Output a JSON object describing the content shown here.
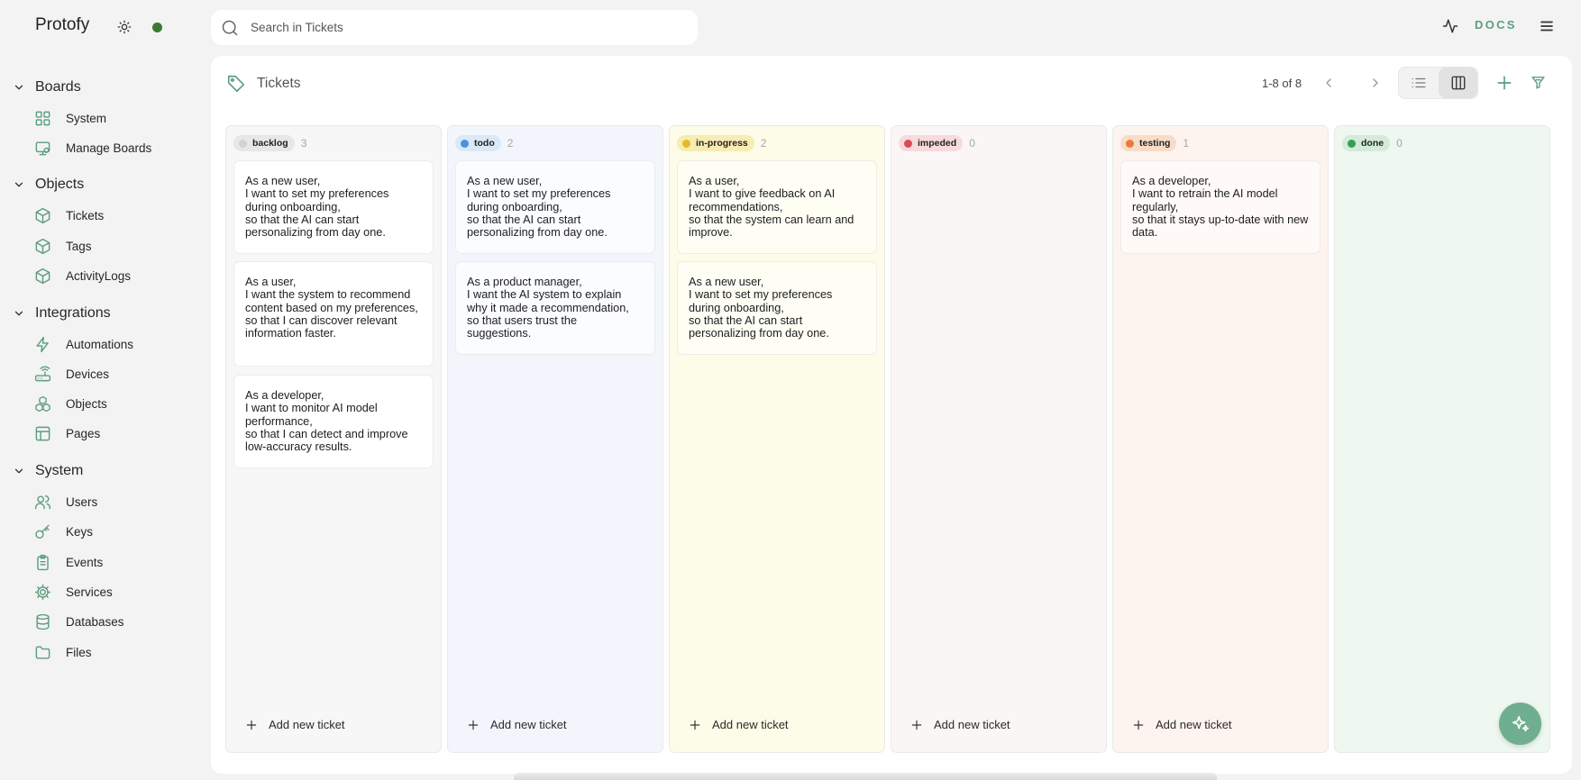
{
  "app": {
    "name": "Protofy",
    "status_color": "#3b7a35",
    "accent": "#5d9e7e"
  },
  "topbar": {
    "search_placeholder": "Search in Tickets",
    "docs_label": "DOCS"
  },
  "sidebar": {
    "sections": [
      {
        "title": "Boards",
        "items": [
          {
            "label": "System",
            "icon": "grid-icon"
          },
          {
            "label": "Manage Boards",
            "icon": "monitor-icon"
          }
        ]
      },
      {
        "title": "Objects",
        "items": [
          {
            "label": "Tickets",
            "icon": "box-icon"
          },
          {
            "label": "Tags",
            "icon": "box-icon"
          },
          {
            "label": "ActivityLogs",
            "icon": "box-icon"
          }
        ]
      },
      {
        "title": "Integrations",
        "items": [
          {
            "label": "Automations",
            "icon": "zap-icon"
          },
          {
            "label": "Devices",
            "icon": "router-icon"
          },
          {
            "label": "Objects",
            "icon": "boxes-icon"
          },
          {
            "label": "Pages",
            "icon": "layout-icon"
          }
        ]
      },
      {
        "title": "System",
        "items": [
          {
            "label": "Users",
            "icon": "users-icon"
          },
          {
            "label": "Keys",
            "icon": "key-icon"
          },
          {
            "label": "Events",
            "icon": "clipboard-icon"
          },
          {
            "label": "Services",
            "icon": "cog-icon"
          },
          {
            "label": "Databases",
            "icon": "database-icon"
          },
          {
            "label": "Files",
            "icon": "folder-icon"
          }
        ]
      }
    ]
  },
  "main": {
    "title": "Tickets",
    "pagination": "1-8 of 8",
    "add_ticket_label": "Add new ticket",
    "columns": [
      {
        "name": "backlog",
        "count": "3",
        "color": "#d2d2d2",
        "badge_bg": "#e7e7e7",
        "col_bg": "#f7f7f7",
        "card_bg": "#ffffff",
        "cards": [
          "As a new user,\nI want to set my preferences during onboarding,\nso that the AI can start personalizing from day one.",
          "As a user,\nI want the system to recommend content based on my preferences,\nso that I can discover relevant information faster.",
          "As a developer,\nI want to monitor AI model performance,\nso that I can detect and improve low-accuracy results."
        ]
      },
      {
        "name": "todo",
        "count": "2",
        "color": "#4e8fde",
        "badge_bg": "#dbe8f8",
        "col_bg": "#f2f6fc",
        "card_bg": "#fafcff",
        "cards": [
          "As a new user,\nI want to set my preferences during onboarding,\nso that the AI can start personalizing from day one.",
          "As a product manager,\nI want the AI system to explain why it made a recommendation,\nso that users trust the suggestions."
        ]
      },
      {
        "name": "in-progress",
        "count": "2",
        "color": "#e6b929",
        "badge_bg": "#f7ecb2",
        "col_bg": "#fcfce8",
        "card_bg": "#fefef5",
        "cards": [
          "As a user,\nI want to give feedback on AI recommendations,\nso that the system can learn and improve.",
          "As a new user,\nI want to set my preferences during onboarding,\nso that the AI can start personalizing from day one."
        ]
      },
      {
        "name": "impeded",
        "count": "0",
        "color": "#dc4a55",
        "badge_bg": "#f6dadc",
        "col_bg": "#fbf6f6",
        "card_bg": "#ffffff",
        "cards": []
      },
      {
        "name": "testing",
        "count": "1",
        "color": "#e77c3a",
        "badge_bg": "#f8dcc8",
        "col_bg": "#fdf4ef",
        "card_bg": "#fffaf7",
        "cards": [
          "As a developer,\nI want to retrain the AI model regularly,\nso that it stays up-to-date with new data."
        ]
      },
      {
        "name": "done",
        "count": "0",
        "color": "#3e9a5a",
        "badge_bg": "#d3ebd9",
        "col_bg": "#eef8f0",
        "card_bg": "#ffffff",
        "cards": []
      }
    ]
  }
}
